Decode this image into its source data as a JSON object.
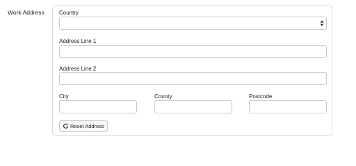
{
  "section": {
    "label": "Work Address"
  },
  "form": {
    "country": {
      "label": "Country",
      "value": ""
    },
    "address_line_1": {
      "label": "Address Line 1",
      "value": ""
    },
    "address_line_2": {
      "label": "Address Line 2",
      "value": ""
    },
    "city": {
      "label": "City",
      "value": ""
    },
    "county": {
      "label": "County",
      "value": ""
    },
    "postcode": {
      "label": "Postcode",
      "value": ""
    },
    "reset_button": {
      "label": "Reset Address",
      "icon": "refresh-icon"
    }
  }
}
